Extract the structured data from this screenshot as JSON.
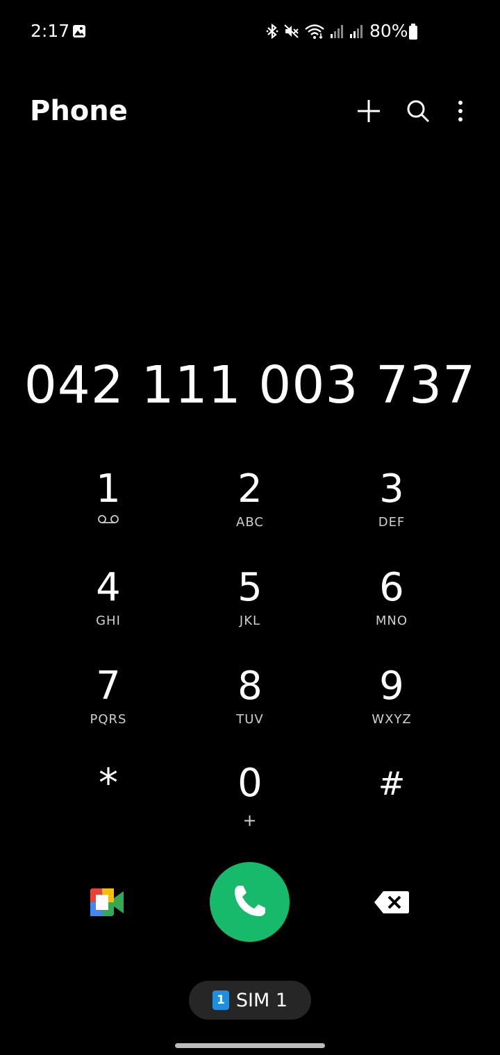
{
  "status": {
    "time": "2:17",
    "battery": "80%",
    "icons": [
      "gallery-icon",
      "bluetooth-icon",
      "mute-icon",
      "wifi-icon",
      "signal-icon",
      "signal-icon",
      "battery-icon"
    ]
  },
  "header": {
    "title": "Phone",
    "actions": [
      "add-icon",
      "search-icon",
      "more-options-icon"
    ]
  },
  "dialed_number": "042 111 003 737",
  "keypad": [
    {
      "digit": "1",
      "letters": "",
      "icon": "voicemail-icon"
    },
    {
      "digit": "2",
      "letters": "ABC"
    },
    {
      "digit": "3",
      "letters": "DEF"
    },
    {
      "digit": "4",
      "letters": "GHI"
    },
    {
      "digit": "5",
      "letters": "JKL"
    },
    {
      "digit": "6",
      "letters": "MNO"
    },
    {
      "digit": "7",
      "letters": "PQRS"
    },
    {
      "digit": "8",
      "letters": "TUV"
    },
    {
      "digit": "9",
      "letters": "WXYZ"
    },
    {
      "digit": "*",
      "letters": ""
    },
    {
      "digit": "0",
      "letters": "+"
    },
    {
      "digit": "#",
      "letters": ""
    }
  ],
  "actions": {
    "video_call_icon": "google-meet-icon",
    "call_icon": "phone-icon",
    "delete_icon": "backspace-icon"
  },
  "sim": {
    "badge": "1",
    "label": "SIM 1"
  },
  "colors": {
    "call_button": "#17b96a",
    "sim_badge": "#1d8ee0",
    "background": "#000000"
  }
}
